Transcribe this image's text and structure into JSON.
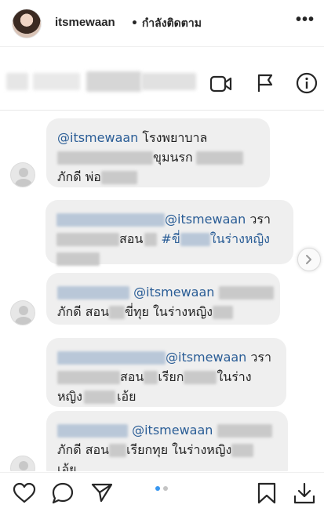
{
  "header": {
    "username": "itsmewaan",
    "follow_status": "• กำลังติดตาม",
    "more_icon": "more-horizontal-icon",
    "more_glyph": "•••"
  },
  "screenshot_topbar": {
    "icons": [
      "video-call-icon",
      "flag-icon",
      "info-icon"
    ]
  },
  "messages": [
    {
      "mention": "@itsmewaan",
      "line1_text": " โรงพยาบาล",
      "line2_text": "ขุมนรก",
      "line3_text": "ภักดี พ่อ"
    },
    {
      "mention": "@itsmewaan",
      "line1_text": " วรา",
      "line2_text": "สอน",
      "hashtag": "#ขี่",
      "hashtag_end": "ในร่างหญิง"
    },
    {
      "mention": "@itsmewaan",
      "line2_text": "ภักดี สอน",
      "line2_text_b": "ขี่ทุย ในร่างหญิง"
    },
    {
      "mention": "@itsmewaan",
      "line1_text": " วรา",
      "line2_text": "สอน",
      "line2_text_b": "เรียก",
      "line2_text_c": "ในร่าง",
      "line3_text": "หญิง",
      "line3_text_b": "เอ้ย"
    },
    {
      "mention": "@itsmewaan",
      "line2_text": "ภักดี สอน",
      "line2_text_b": "เรียกทุย ในร่างหญิง",
      "line3_text": "เอ้ย"
    }
  ],
  "footer": {
    "icons": [
      "heart-icon",
      "comment-icon",
      "share-icon",
      "bookmark-icon",
      "download-icon"
    ],
    "carousel": {
      "total": 2,
      "active": 1
    },
    "colors": {
      "active_dot": "#3897f0",
      "inactive_dot": "#c4c4c4"
    }
  }
}
